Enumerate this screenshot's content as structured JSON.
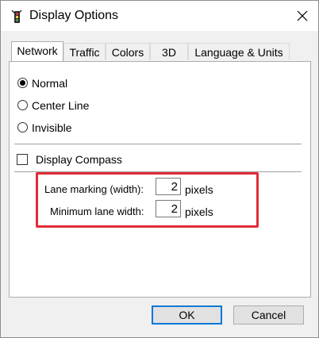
{
  "window": {
    "title": "Display Options",
    "icon": "traffic-light-icon",
    "close_icon": "close-icon"
  },
  "tabs": [
    {
      "label": "Network",
      "active": true
    },
    {
      "label": "Traffic",
      "active": false
    },
    {
      "label": "Colors",
      "active": false
    },
    {
      "label": "3D",
      "active": false
    },
    {
      "label": "Language & Units",
      "active": false
    }
  ],
  "network": {
    "display_mode": {
      "options": [
        "Normal",
        "Center Line",
        "Invisible"
      ],
      "selected": "Normal"
    },
    "compass": {
      "label": "Display Compass",
      "checked": false
    },
    "lane_marking": {
      "label": "Lane marking (width):",
      "value": "2",
      "unit": "pixels"
    },
    "min_lane_width": {
      "label": "Minimum lane width:",
      "value": "2",
      "unit": "pixels"
    },
    "highlight_color": "#e02c38"
  },
  "buttons": {
    "ok": "OK",
    "cancel": "Cancel"
  }
}
